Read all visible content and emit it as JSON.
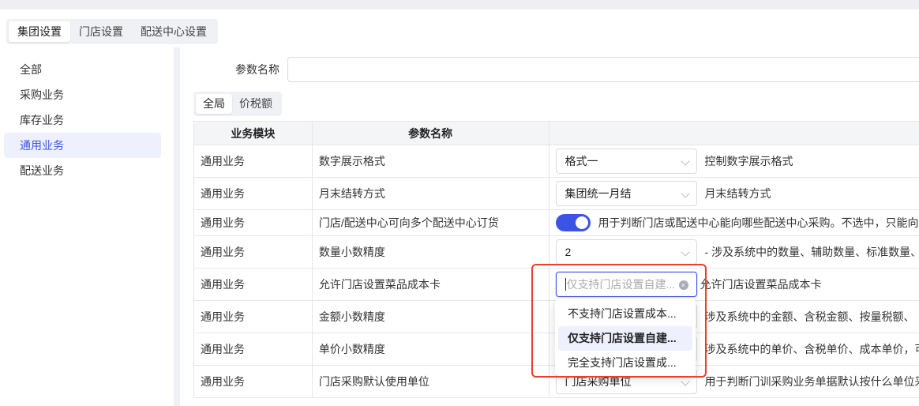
{
  "main_tabs": [
    "集团设置",
    "门店设置",
    "配送中心设置"
  ],
  "sidebar": {
    "items": [
      "全部",
      "采购业务",
      "库存业务",
      "通用业务",
      "配送业务"
    ],
    "active_index": 3
  },
  "filter": {
    "label": "参数名称",
    "value": ""
  },
  "sub_tabs": [
    "全局",
    "价税额"
  ],
  "table": {
    "headers": [
      "业务模块",
      "参数名称",
      ""
    ],
    "rows": [
      {
        "module": "通用业务",
        "name": "数字展示格式",
        "control": "select",
        "value": "格式一",
        "desc": "控制数字展示格式"
      },
      {
        "module": "通用业务",
        "name": "月末结转方式",
        "control": "select",
        "value": "集团统一月结",
        "desc": "月末结转方式"
      },
      {
        "module": "通用业务",
        "name": "门店/配送中心可向多个配送中心订货",
        "control": "toggle",
        "value": "on",
        "desc": "用于判断门店或配送中心能向哪些配送中心采购。不选中，只能向"
      },
      {
        "module": "通用业务",
        "name": "数量小数精度",
        "control": "select",
        "value": "2",
        "desc": "- 涉及系统中的数量、辅助数量、标准数量、"
      },
      {
        "module": "通用业务",
        "name": "允许门店设置菜品成本卡",
        "control": "select-open",
        "value": "仅支持门店设置自建...",
        "desc": "允许门店设置菜品成本卡"
      },
      {
        "module": "通用业务",
        "name": "金额小数精度",
        "control": "select",
        "value": "",
        "desc": "涉及系统中的金额、含税金额、按量税额、"
      },
      {
        "module": "通用业务",
        "name": "单价小数精度",
        "control": "select",
        "value": "",
        "desc": "涉及系统中的单价、含税单价、成本单价，可"
      },
      {
        "module": "通用业务",
        "name": "门店采购默认使用单位",
        "control": "select",
        "value": "门店采购单位",
        "desc": "用于判断门训采购业务单据默认按什么单位采"
      }
    ]
  },
  "dropdown": {
    "options": [
      "不支持门店设置成本...",
      "仅支持门店设置自建...",
      "完全支持门店设置成..."
    ],
    "selected_index": 1
  },
  "colors": {
    "accent": "#3b54e6",
    "highlight": "#e8402d"
  }
}
